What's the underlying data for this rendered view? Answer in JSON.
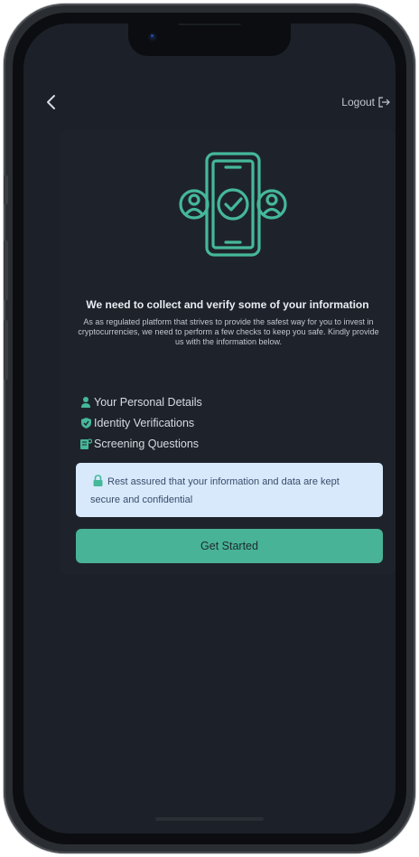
{
  "header": {
    "back_icon": "chevron-left-icon",
    "logout_label": "Logout",
    "logout_icon": "logout-arrow-icon"
  },
  "card": {
    "hero_icon": "phone-verified-users-icon",
    "title": "We need to collect and verify some of your information",
    "description": "As as regulated platform that strives to provide the safest way for you to invest in cryptocurrencies, we need to perform a few checks to keep you safe. Kindly provide us with the information below.",
    "checklist": [
      {
        "icon": "user-icon",
        "label": "Your Personal Details"
      },
      {
        "icon": "shield-check-icon",
        "label": "Identity Verifications"
      },
      {
        "icon": "questionnaire-icon",
        "label": "Screening Questions"
      }
    ],
    "notice": {
      "icon": "lock-icon",
      "text": "Rest assured that your information and data are kept secure and confidential"
    },
    "cta_label": "Get Started"
  },
  "colors": {
    "accent": "#48b396",
    "background": "#1c2028",
    "card": "#1e232b",
    "notice_bg": "#d7e9fb"
  }
}
